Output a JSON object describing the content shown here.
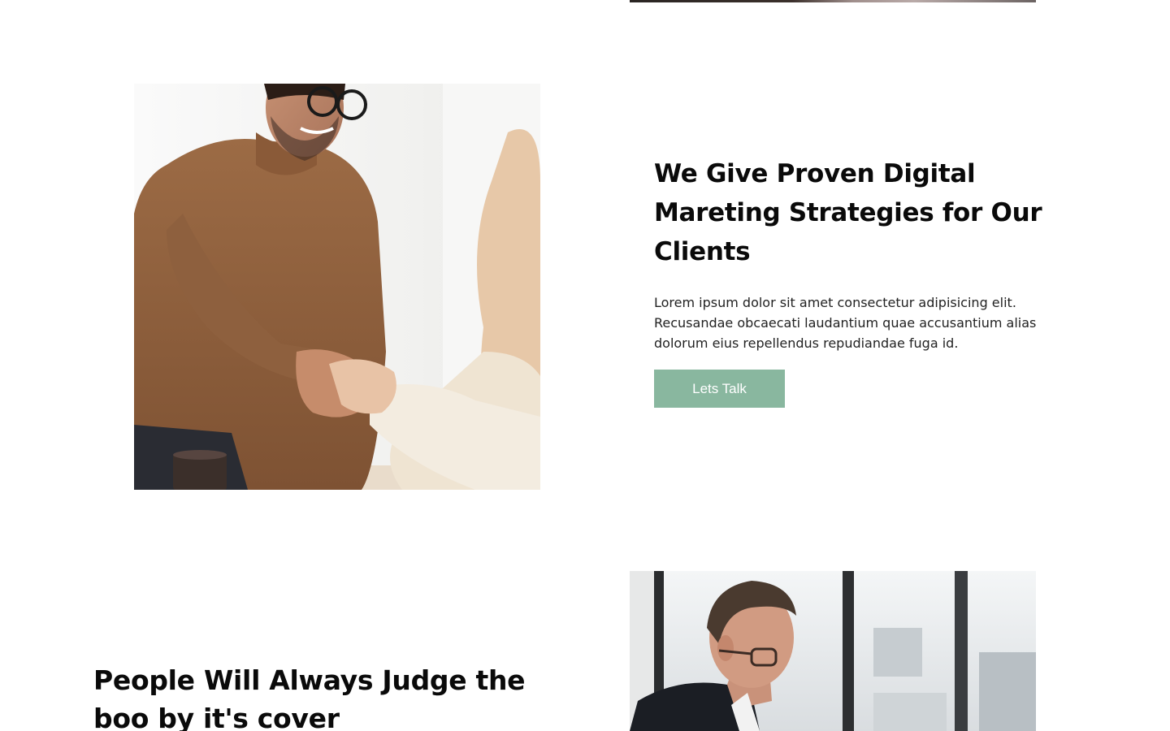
{
  "section_strategies": {
    "image_alt": "Two people shaking hands across a table",
    "heading": "We Give Proven Digital Mareting Strategies for Our Clients",
    "body": "Lorem ipsum dolor sit amet consectetur adipisicing elit. Recusandae obcaecati laudantium quae accusantium alias dolorum eius repellendus repudiandae fuga id.",
    "button_label": "Lets Talk"
  },
  "section_judge": {
    "heading": "People Will Always Judge the boo by it's cover",
    "image_alt": "Man with glasses in suit looking down by a window"
  },
  "colors": {
    "accent": "#89b79f",
    "heading": "#0a0a0a",
    "body": "#222222",
    "background": "#ffffff"
  }
}
